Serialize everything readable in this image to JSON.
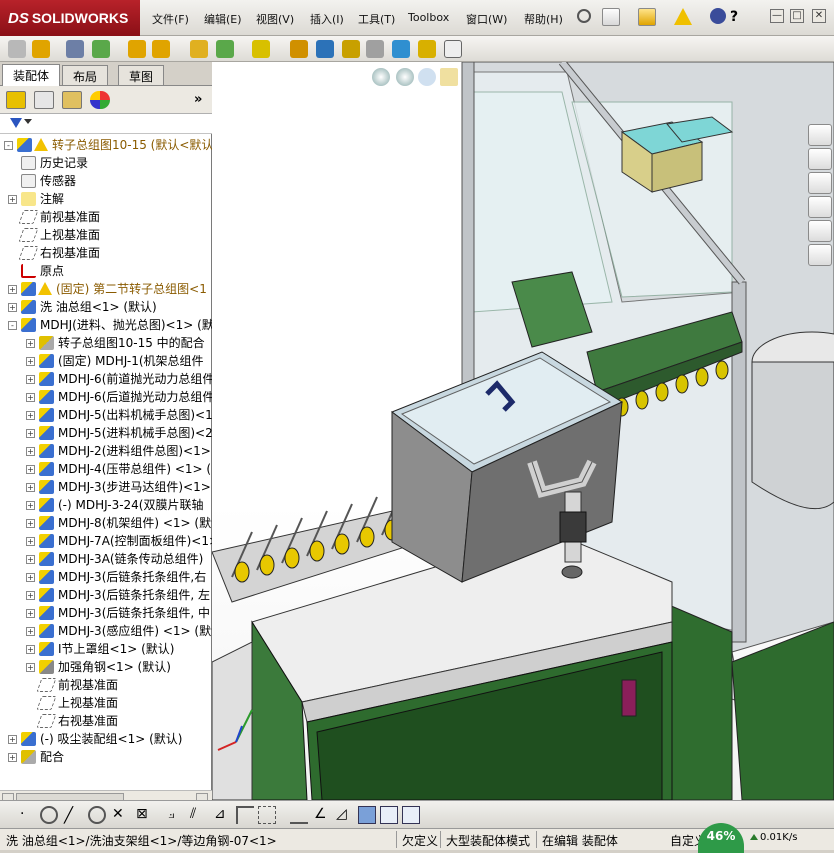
{
  "app": {
    "logo_prefix": "DS",
    "logo_text": "SOLIDWORKS"
  },
  "menu": [
    "文件(F)",
    "编辑(E)",
    "视图(V)",
    "插入(I)",
    "工具(T)",
    "Toolbox",
    "窗口(W)",
    "帮助(H)"
  ],
  "window_controls": {
    "minimize": "—",
    "restore": "□",
    "close": "✕",
    "help": "?"
  },
  "panel_tabs": [
    "装配体",
    "布局",
    "草图"
  ],
  "tree": [
    {
      "label": "转子总组图10-15  (默认<默认_",
      "indent": 0,
      "icon": "assembly-icon",
      "warn": true,
      "expand": "-",
      "color": "#8a5b00"
    },
    {
      "label": "历史记录",
      "indent": 1,
      "icon": "history-icon",
      "expand": "",
      "color": "#000"
    },
    {
      "label": "传感器",
      "indent": 1,
      "icon": "sensor-icon",
      "expand": "",
      "color": "#000"
    },
    {
      "label": "注解",
      "indent": 1,
      "icon": "annotation-icon",
      "expand": "+",
      "color": "#000"
    },
    {
      "label": "前视基准面",
      "indent": 1,
      "icon": "plane-icon",
      "expand": "",
      "color": "#000"
    },
    {
      "label": "上视基准面",
      "indent": 1,
      "icon": "plane-icon",
      "expand": "",
      "color": "#000"
    },
    {
      "label": "右视基准面",
      "indent": 1,
      "icon": "plane-icon",
      "expand": "",
      "color": "#000"
    },
    {
      "label": "原点",
      "indent": 1,
      "icon": "origin-icon",
      "expand": "",
      "color": "#000"
    },
    {
      "label": "(固定) 第二节转子总组图<1",
      "indent": 1,
      "icon": "assembly-icon",
      "warn": true,
      "expand": "+",
      "color": "#8a5b00"
    },
    {
      "label": "洗 油总组<1> (默认)",
      "indent": 1,
      "icon": "assembly-icon",
      "expand": "+",
      "color": "#000"
    },
    {
      "label": "MDHJ(进料、抛光总图)<1> (默",
      "indent": 1,
      "icon": "assembly-icon",
      "expand": "-",
      "color": "#000"
    },
    {
      "label": "转子总组图10-15 中的配合",
      "indent": 2,
      "icon": "mates-icon",
      "expand": "+",
      "color": "#000"
    },
    {
      "label": "(固定) MDHJ-1(机架总组件",
      "indent": 2,
      "icon": "assembly-icon",
      "expand": "+",
      "color": "#000"
    },
    {
      "label": "MDHJ-6(前道抛光动力总组件",
      "indent": 2,
      "icon": "assembly-icon",
      "expand": "+",
      "color": "#000"
    },
    {
      "label": "MDHJ-6(后道抛光动力总组件",
      "indent": 2,
      "icon": "assembly-icon",
      "expand": "+",
      "color": "#000"
    },
    {
      "label": "MDHJ-5(出料机械手总图)<1>",
      "indent": 2,
      "icon": "assembly-icon",
      "expand": "+",
      "color": "#000"
    },
    {
      "label": "MDHJ-5(进料机械手总图)<2",
      "indent": 2,
      "icon": "assembly-icon",
      "expand": "+",
      "color": "#000"
    },
    {
      "label": "MDHJ-2(进料组件总图)<1>",
      "indent": 2,
      "icon": "assembly-icon",
      "expand": "+",
      "color": "#000"
    },
    {
      "label": "MDHJ-4(压带总组件) <1> (",
      "indent": 2,
      "icon": "assembly-icon",
      "expand": "+",
      "color": "#000"
    },
    {
      "label": "MDHJ-3(步进马达组件)<1>",
      "indent": 2,
      "icon": "assembly-icon",
      "expand": "+",
      "color": "#000"
    },
    {
      "label": "(-) MDHJ-3-24(双膜片联轴",
      "indent": 2,
      "icon": "assembly-icon",
      "expand": "+",
      "color": "#000"
    },
    {
      "label": "MDHJ-8(机架组件) <1> (默认",
      "indent": 2,
      "icon": "assembly-icon",
      "expand": "+",
      "color": "#000"
    },
    {
      "label": "MDHJ-7A(控制面板组件)<1>",
      "indent": 2,
      "icon": "assembly-icon",
      "expand": "+",
      "color": "#000"
    },
    {
      "label": "MDHJ-3A(链条传动总组件)",
      "indent": 2,
      "icon": "assembly-icon",
      "expand": "+",
      "color": "#000"
    },
    {
      "label": "MDHJ-3(后链条托条组件,右",
      "indent": 2,
      "icon": "assembly-icon",
      "expand": "+",
      "color": "#000"
    },
    {
      "label": "MDHJ-3(后链条托条组件, 左",
      "indent": 2,
      "icon": "assembly-icon",
      "expand": "+",
      "color": "#000"
    },
    {
      "label": "MDHJ-3(后链条托条组件, 中",
      "indent": 2,
      "icon": "assembly-icon",
      "expand": "+",
      "color": "#000"
    },
    {
      "label": "MDHJ-3(感应组件) <1> (默认",
      "indent": 2,
      "icon": "assembly-icon",
      "expand": "+",
      "color": "#000"
    },
    {
      "label": "I节上罩组<1> (默认)",
      "indent": 2,
      "icon": "assembly-icon",
      "expand": "+",
      "color": "#000"
    },
    {
      "label": "加强角钢<1> (默认)",
      "indent": 2,
      "icon": "part-icon",
      "expand": "+",
      "color": "#000"
    },
    {
      "label": "前视基准面",
      "indent": 2,
      "icon": "plane-icon",
      "expand": "",
      "color": "#000"
    },
    {
      "label": "上视基准面",
      "indent": 2,
      "icon": "plane-icon",
      "expand": "",
      "color": "#000"
    },
    {
      "label": "右视基准面",
      "indent": 2,
      "icon": "plane-icon",
      "expand": "",
      "color": "#000"
    },
    {
      "label": "(-) 吸尘装配组<1> (默认)",
      "indent": 1,
      "icon": "assembly-icon",
      "expand": "+",
      "color": "#000"
    },
    {
      "label": "配合",
      "indent": 1,
      "icon": "mates-icon",
      "expand": "+",
      "color": "#000"
    }
  ],
  "status": {
    "path": "洗 油总组<1>/洗油支架组<1>/等边角钢-07<1>",
    "definition": "欠定义",
    "mode": "大型装配体模式",
    "editing": "在编辑 装配体",
    "custom": "自定义",
    "percent": "46%",
    "speed": "0.01K/s"
  },
  "colors": {
    "brand": "#a8161f",
    "machine_green": "#2e6b2e",
    "frame_gray": "#c8ccd0",
    "accent_yellow": "#e3c400"
  }
}
